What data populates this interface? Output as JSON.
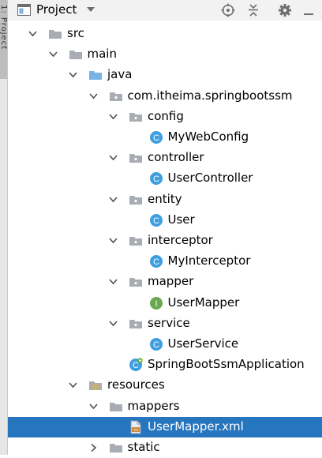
{
  "side_panel": {
    "label": "1: Project"
  },
  "header": {
    "title": "Project"
  },
  "colors": {
    "selection": "#2675bf",
    "folder_gray": "#a8adb3",
    "source_folder_blue": "#7ab3e6",
    "class_badge": "#3d9ee0",
    "interface_badge": "#6aa84f",
    "icon_gray": "#6e6e6e"
  },
  "tree": [
    {
      "label": "src",
      "icon": "folder-icon",
      "expanded": true,
      "depth": 0
    },
    {
      "label": "main",
      "icon": "folder-icon",
      "expanded": true,
      "depth": 1
    },
    {
      "label": "java",
      "icon": "source-folder-icon",
      "expanded": true,
      "depth": 2
    },
    {
      "label": "com.itheima.springbootssm",
      "icon": "package-icon",
      "expanded": true,
      "depth": 3
    },
    {
      "label": "config",
      "icon": "package-icon",
      "expanded": true,
      "depth": 4
    },
    {
      "label": "MyWebConfig",
      "icon": "class-icon",
      "depth": 5
    },
    {
      "label": "controller",
      "icon": "package-icon",
      "expanded": true,
      "depth": 4
    },
    {
      "label": "UserController",
      "icon": "class-icon",
      "depth": 5
    },
    {
      "label": "entity",
      "icon": "package-icon",
      "expanded": true,
      "depth": 4
    },
    {
      "label": "User",
      "icon": "class-icon",
      "depth": 5
    },
    {
      "label": "interceptor",
      "icon": "package-icon",
      "expanded": true,
      "depth": 4
    },
    {
      "label": "MyInterceptor",
      "icon": "class-icon",
      "depth": 5
    },
    {
      "label": "mapper",
      "icon": "package-icon",
      "expanded": true,
      "depth": 4
    },
    {
      "label": "UserMapper",
      "icon": "interface-icon",
      "depth": 5
    },
    {
      "label": "service",
      "icon": "package-icon",
      "expanded": true,
      "depth": 4
    },
    {
      "label": "UserService",
      "icon": "class-icon",
      "depth": 5
    },
    {
      "label": "SpringBootSsmApplication",
      "icon": "spring-boot-class-icon",
      "depth": 4
    },
    {
      "label": "resources",
      "icon": "resources-folder-icon",
      "expanded": true,
      "depth": 2
    },
    {
      "label": "mappers",
      "icon": "folder-icon",
      "expanded": true,
      "depth": 3
    },
    {
      "label": "UserMapper.xml",
      "icon": "xml-file-icon",
      "selected": true,
      "depth": 4
    },
    {
      "label": "static",
      "icon": "folder-icon",
      "expanded": false,
      "depth": 3
    }
  ]
}
